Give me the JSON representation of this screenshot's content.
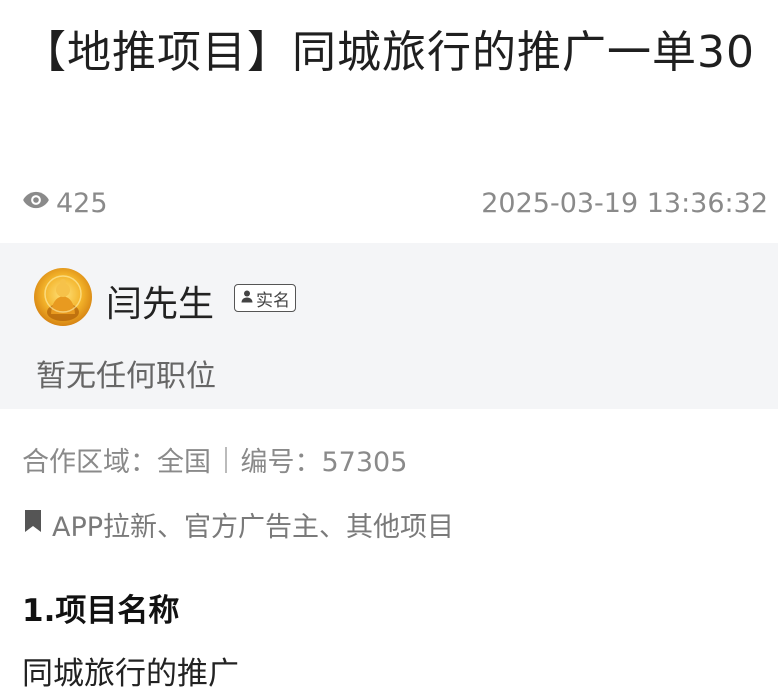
{
  "post": {
    "title": "【地推项目】同城旅行的推广一单30",
    "views": "425",
    "timestamp": "2025-03-19 13:36:32"
  },
  "author": {
    "name": "闫先生",
    "verify_label": "实名",
    "role": "暂无任何职位"
  },
  "info": {
    "region": "合作区域：全国",
    "code": "编号：57305"
  },
  "tags": "APP拉新、官方广告主、其他项目",
  "section": {
    "heading": "1.项目名称",
    "body": "同城旅行的推广"
  },
  "icons": {
    "views": "eye-icon",
    "verify": "person-icon",
    "tags": "bookmark-icon"
  },
  "colors": {
    "panel_bg": "#f4f5f7",
    "meta_text": "#8a8a8a"
  }
}
